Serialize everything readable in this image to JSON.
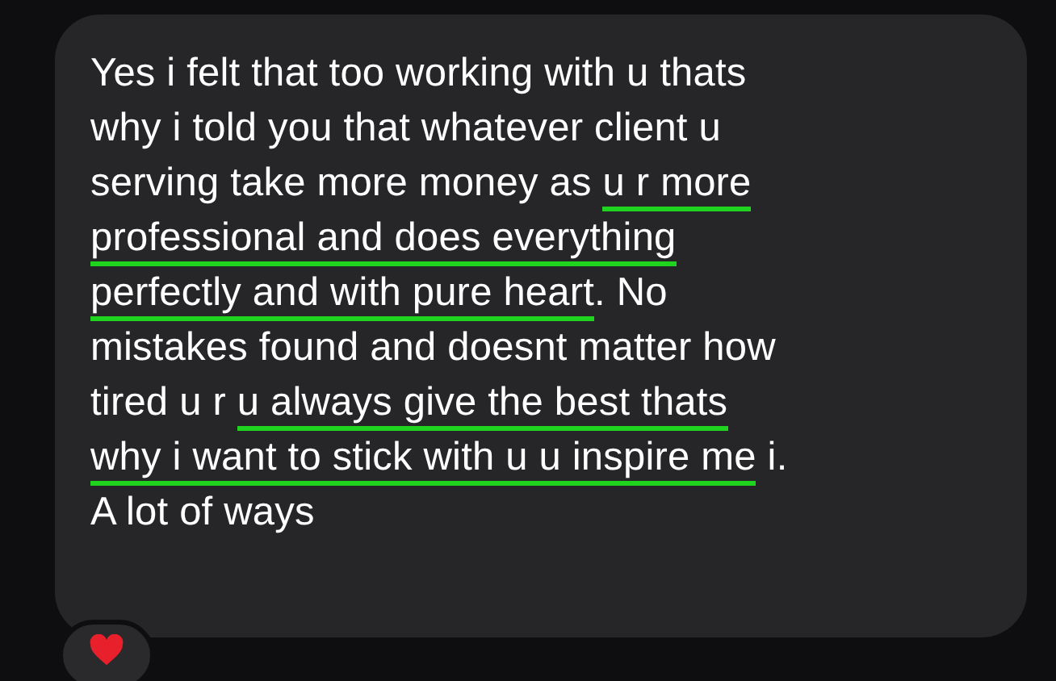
{
  "message": {
    "lines": [
      [
        {
          "text": "Yes i felt that too working with u thats",
          "underlined": false
        }
      ],
      [
        {
          "text": "why i told you that whatever client u",
          "underlined": false
        }
      ],
      [
        {
          "text": "serving take more money as ",
          "underlined": false
        },
        {
          "text": "u r more",
          "underlined": true
        }
      ],
      [
        {
          "text": "professional and does everything",
          "underlined": true
        }
      ],
      [
        {
          "text": "perfectly and with pure heart",
          "underlined": true
        },
        {
          "text": ". No",
          "underlined": false
        }
      ],
      [
        {
          "text": "mistakes found and doesnt matter how",
          "underlined": false
        }
      ],
      [
        {
          "text": "tired u r ",
          "underlined": false
        },
        {
          "text": "u always give the best thats",
          "underlined": true
        }
      ],
      [
        {
          "text": "why i want to stick with u u inspire me",
          "underlined": true
        },
        {
          "text": " i.",
          "underlined": false
        }
      ],
      [
        {
          "text": "A lot of ways",
          "underlined": false
        }
      ]
    ]
  },
  "reaction": {
    "kind": "heart"
  }
}
